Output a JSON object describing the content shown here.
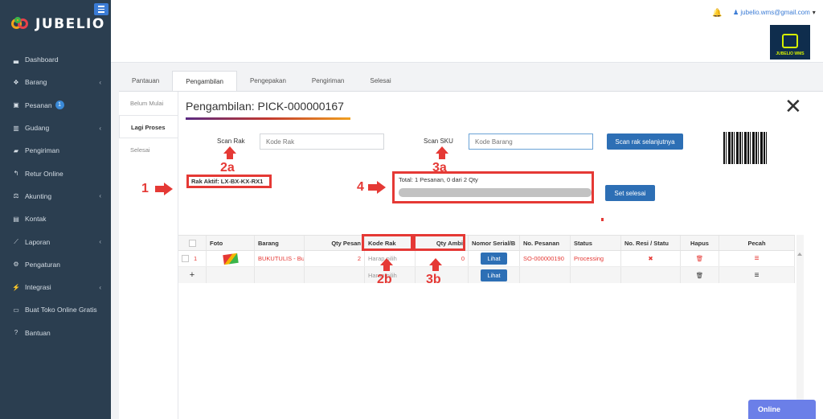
{
  "brand": {
    "name": "JUBELIO"
  },
  "sidebar": {
    "items": [
      {
        "label": "Dashboard",
        "icon": "dashboard-icon",
        "glyph": "▃",
        "chevron": false
      },
      {
        "label": "Barang",
        "icon": "cubes-icon",
        "glyph": "❖",
        "chevron": true
      },
      {
        "label": "Pesanan",
        "icon": "basket-icon",
        "glyph": "▣",
        "chevron": false,
        "badge": "1"
      },
      {
        "label": "Gudang",
        "icon": "building-icon",
        "glyph": "▥",
        "chevron": true
      },
      {
        "label": "Pengiriman",
        "icon": "truck-icon",
        "glyph": "▰",
        "chevron": false
      },
      {
        "label": "Retur Online",
        "icon": "reply-icon",
        "glyph": "↰",
        "chevron": false
      },
      {
        "label": "Akunting",
        "icon": "balance-icon",
        "glyph": "⚖",
        "chevron": true
      },
      {
        "label": "Kontak",
        "icon": "contact-card-icon",
        "glyph": "▤",
        "chevron": false
      },
      {
        "label": "Laporan",
        "icon": "line-chart-icon",
        "glyph": "⟋",
        "chevron": true
      },
      {
        "label": "Pengaturan",
        "icon": "cogs-icon",
        "glyph": "⚙",
        "chevron": false
      },
      {
        "label": "Integrasi",
        "icon": "plug-icon",
        "glyph": "⚡",
        "chevron": true
      },
      {
        "label": "Buat Toko Online Gratis",
        "icon": "cart-icon",
        "glyph": "▭",
        "chevron": false
      },
      {
        "label": "Bantuan",
        "icon": "question-icon",
        "glyph": "?",
        "chevron": false
      }
    ]
  },
  "header": {
    "user_email": "jubelio.wms@gmail.com",
    "wms_logo_text": "JUBELIO WMS"
  },
  "tabs": [
    {
      "label": "Pantauan",
      "active": false
    },
    {
      "label": "Pengambilan",
      "active": true
    },
    {
      "label": "Pengepakan",
      "active": false
    },
    {
      "label": "Pengiriman",
      "active": false
    },
    {
      "label": "Selesai",
      "active": false
    }
  ],
  "subtabs": [
    {
      "label": "Belum Mulai",
      "active": false
    },
    {
      "label": "Lagi Proses",
      "active": true
    },
    {
      "label": "Selesai",
      "active": false
    }
  ],
  "modal": {
    "title": "Pengambilan: PICK-000000167",
    "close_glyph": "✕",
    "scan_rak_label": "Scan Rak",
    "scan_rak_placeholder": "Kode Rak",
    "scan_sku_label": "Scan SKU",
    "scan_sku_placeholder": "Kode Barang",
    "next_rack_button": "Scan rak selanjutnya",
    "rak_aktif": "Rak Aktif: LX-BX-KX-RX1",
    "total_text": "Total: 1 Pesanan, 0 dari 2 Qty",
    "finish_button": "Set selesai"
  },
  "annotations": {
    "a1": "1",
    "a2a": "2a",
    "a3a": "3a",
    "a4": "4",
    "a2b": "2b",
    "a3b": "3b",
    "color": "#e53935"
  },
  "table": {
    "headers": [
      "",
      "Foto",
      "Barang",
      "Qty Pesan",
      "Kode Rak",
      "Qty Ambil",
      "Nomor Serial/B",
      "No. Pesanan",
      "Status",
      "No. Resi / Statu",
      "Hapus",
      "Pecah"
    ],
    "row1": {
      "no": "1",
      "barang": "BUKUTULIS - Bu",
      "qty_pesan": "2",
      "kode_rak": "Harap pilih",
      "qty_ambil": "0",
      "serial_button": "Lihat",
      "no_pesanan": "SO-000000190",
      "status": "Processing",
      "resi": "✖",
      "hapus": "🗑",
      "pecah": "≡"
    },
    "row2": {
      "add": "+",
      "kode_rak": "Harap pilih",
      "serial_button": "Lihat",
      "hapus": "🗑",
      "pecah": "≡"
    }
  },
  "chat": {
    "label": "Online"
  }
}
